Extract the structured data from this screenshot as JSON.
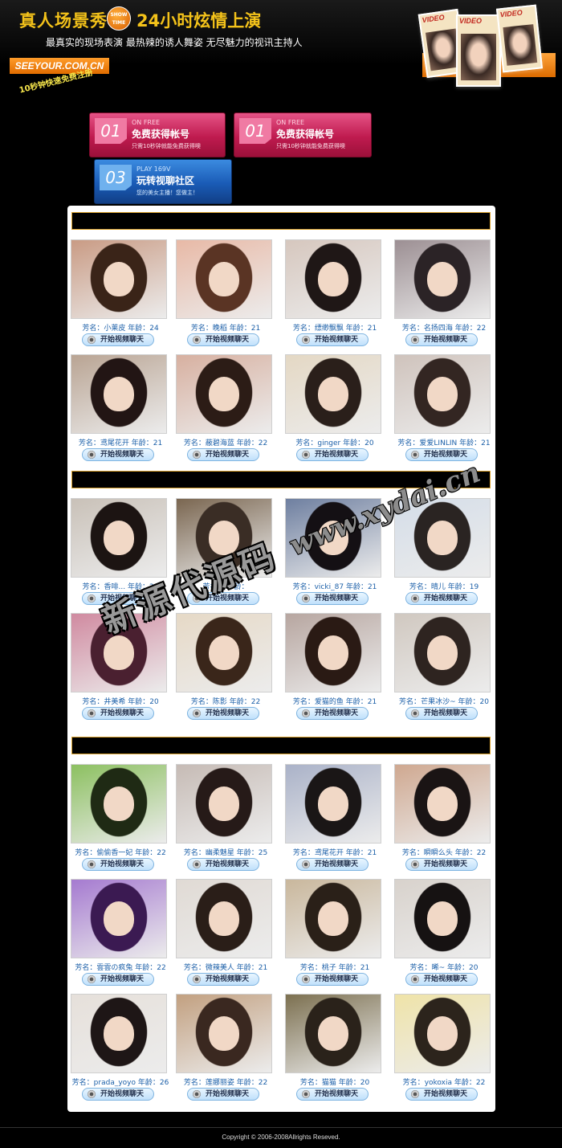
{
  "header": {
    "title_left": "真人场景秀",
    "badge": "SHOW TIME",
    "title_right": "24小时炫情上演",
    "subtitle": "最真实的现场表演  最热辣的诱人舞姿  无尽魅力的视讯主持人",
    "logo": "SEEYOUR.COM.CN",
    "register": "10秒钟快速免费注册",
    "cover_label": "VIDEO"
  },
  "promos": [
    {
      "num": "01",
      "en": "ON FREE",
      "cn": "免费获得帐号",
      "desc": "只需10秒钟就能免费获得噢",
      "color": "pink"
    },
    {
      "num": "01",
      "en": "ON FREE",
      "cn": "免费获得帐号",
      "desc": "只需10秒钟就能免费获得噢",
      "color": "pink"
    },
    {
      "num": "03",
      "en": "PLAY 169V",
      "cn": "玩转视聊社区",
      "desc": "您的美女主播！您做主！",
      "color": "blue"
    }
  ],
  "button_label": "开始视频聊天",
  "name_prefix": "芳名：",
  "age_prefix": "年龄：",
  "sections": [
    {
      "cards": [
        {
          "name": "小莱皮",
          "age": "24"
        },
        {
          "name": "晚稻",
          "age": "21"
        },
        {
          "name": "缥缈飘飘",
          "age": "21"
        },
        {
          "name": "名扬四海",
          "age": "22"
        },
        {
          "name": "鸢尾花开",
          "age": "21"
        },
        {
          "name": "蔽碧海蓝",
          "age": "22"
        },
        {
          "name": "ginger",
          "age": "20"
        },
        {
          "name": "爱爱LINLIN",
          "age": "21"
        }
      ]
    },
    {
      "cards": [
        {
          "name": "香啡...",
          "age": "20"
        },
        {
          "name": "",
          "age": ""
        },
        {
          "name": "vicki_87",
          "age": "21"
        },
        {
          "name": "晴儿",
          "age": "19"
        },
        {
          "name": "井美希",
          "age": "20"
        },
        {
          "name": "陈影",
          "age": "22"
        },
        {
          "name": "爱猫的鱼",
          "age": "21"
        },
        {
          "name": "芒果冰沙~",
          "age": "20"
        }
      ]
    },
    {
      "cards": [
        {
          "name": "偷偷香一妃",
          "age": "22"
        },
        {
          "name": "幽柔魅星",
          "age": "25"
        },
        {
          "name": "鸢尾花开",
          "age": "21"
        },
        {
          "name": "瞬瞬么头",
          "age": "22"
        },
        {
          "name": "雲雲の疯兔",
          "age": "22"
        },
        {
          "name": "微辣美人",
          "age": "21"
        },
        {
          "name": "桃子",
          "age": "21"
        },
        {
          "name": "晞~",
          "age": "20"
        },
        {
          "name": "prada_yoyo",
          "age": "26"
        },
        {
          "name": "莲娜丽姿",
          "age": "22"
        },
        {
          "name": "猫猫",
          "age": "20"
        },
        {
          "name": "yokoxia",
          "age": "22"
        }
      ]
    }
  ],
  "watermark": {
    "url": "www.xydai.cn",
    "cn": "新源代源码"
  },
  "footer": "Copyright © 2006-2008Allrights Reseved."
}
